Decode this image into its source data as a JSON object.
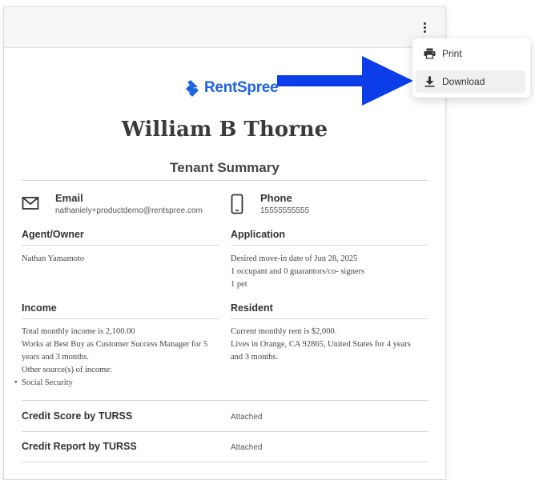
{
  "brand": {
    "name": "RentSpree",
    "color": "#1f63e0"
  },
  "report": {
    "tenant_name": "William B Thorne",
    "title": "Tenant Summary"
  },
  "contact": {
    "email": {
      "label": "Email",
      "value": "nathaniely+productdemo@rentspree.com",
      "icon": "mail-icon"
    },
    "phone": {
      "label": "Phone",
      "value": "15555555555",
      "icon": "phone-icon"
    }
  },
  "sections": {
    "agent_owner": {
      "title": "Agent/Owner",
      "lines": [
        "Nathan Yamamoto"
      ]
    },
    "application": {
      "title": "Application",
      "lines": [
        "Desired move-in date of Jun 28, 2025",
        "1 occupant and 0 guarantors/co- signers",
        "1 pet"
      ]
    },
    "income": {
      "title": "Income",
      "lines": [
        "Total monthly income is 2,100.00",
        "Works at Best Buy as Customer Success Manager for 5",
        "years and 3 months.",
        "Other source(s) of income:"
      ],
      "bullets": [
        "Social Security"
      ]
    },
    "resident": {
      "title": "Resident",
      "lines": [
        "Current monthly rent is $2,000.",
        "Lives in Orange, CA 92865, United States for 4 years",
        "and 3 months."
      ]
    }
  },
  "rows": [
    {
      "title": "Credit Score by TURSS",
      "value": "Attached"
    },
    {
      "title": "Credit Report by TURSS",
      "value": "Attached"
    }
  ],
  "menu": {
    "items": [
      {
        "label": "Print",
        "icon": "printer-icon"
      },
      {
        "label": "Download",
        "icon": "download-icon",
        "highlighted": true
      }
    ]
  },
  "annotation": {
    "arrow_color": "#0b3de8"
  }
}
